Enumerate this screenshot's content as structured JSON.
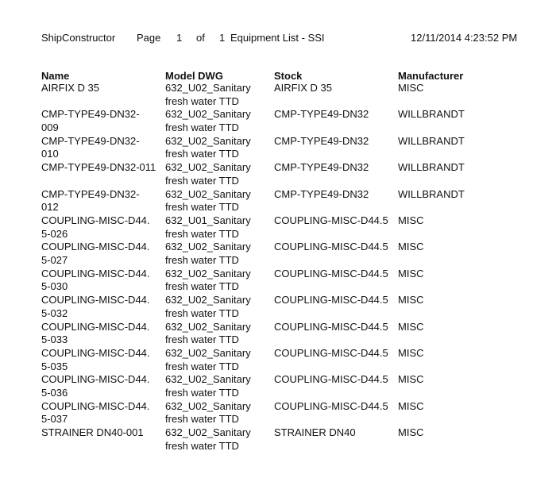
{
  "header": {
    "app_name": "ShipConstructor",
    "page_label": "Page",
    "page_number": "1",
    "of_label": "of",
    "page_total": "1",
    "report_title": "Equipment List - SSI",
    "timestamp": "12/11/2014 4:23:52 PM"
  },
  "table": {
    "columns": [
      "Name",
      "Model DWG",
      "Stock",
      "Manufacturer"
    ],
    "rows": [
      {
        "name": "AIRFIX D 35",
        "model": "632_U02_Sanitary\nfresh water TTD",
        "stock": "AIRFIX D 35",
        "manufacturer": "MISC"
      },
      {
        "name": "CMP-TYPE49-DN32-\n009",
        "model": "632_U02_Sanitary\nfresh water TTD",
        "stock": "CMP-TYPE49-DN32",
        "manufacturer": "WILLBRANDT"
      },
      {
        "name": "CMP-TYPE49-DN32-\n010",
        "model": "632_U02_Sanitary\nfresh water TTD",
        "stock": "CMP-TYPE49-DN32",
        "manufacturer": "WILLBRANDT"
      },
      {
        "name": "CMP-TYPE49-DN32-011",
        "model": "632_U02_Sanitary\nfresh water TTD",
        "stock": "CMP-TYPE49-DN32",
        "manufacturer": "WILLBRANDT"
      },
      {
        "name": "CMP-TYPE49-DN32-\n012",
        "model": "632_U02_Sanitary\nfresh water TTD",
        "stock": "CMP-TYPE49-DN32",
        "manufacturer": "WILLBRANDT"
      },
      {
        "name": "COUPLING-MISC-D44.\n5-026",
        "model": "632_U01_Sanitary\nfresh water TTD",
        "stock": "COUPLING-MISC-D44.5",
        "manufacturer": "MISC"
      },
      {
        "name": "COUPLING-MISC-D44.\n5-027",
        "model": "632_U02_Sanitary\nfresh water TTD",
        "stock": "COUPLING-MISC-D44.5",
        "manufacturer": "MISC"
      },
      {
        "name": "COUPLING-MISC-D44.\n5-030",
        "model": "632_U02_Sanitary\nfresh water TTD",
        "stock": "COUPLING-MISC-D44.5",
        "manufacturer": "MISC"
      },
      {
        "name": "COUPLING-MISC-D44.\n5-032",
        "model": "632_U02_Sanitary\nfresh water TTD",
        "stock": "COUPLING-MISC-D44.5",
        "manufacturer": "MISC"
      },
      {
        "name": "COUPLING-MISC-D44.\n5-033",
        "model": "632_U02_Sanitary\nfresh water TTD",
        "stock": "COUPLING-MISC-D44.5",
        "manufacturer": "MISC"
      },
      {
        "name": "COUPLING-MISC-D44.\n5-035",
        "model": "632_U02_Sanitary\nfresh water TTD",
        "stock": "COUPLING-MISC-D44.5",
        "manufacturer": "MISC"
      },
      {
        "name": "COUPLING-MISC-D44.\n5-036",
        "model": "632_U02_Sanitary\nfresh water TTD",
        "stock": "COUPLING-MISC-D44.5",
        "manufacturer": "MISC"
      },
      {
        "name": "COUPLING-MISC-D44.\n5-037",
        "model": "632_U02_Sanitary\nfresh water TTD",
        "stock": "COUPLING-MISC-D44.5",
        "manufacturer": "MISC"
      },
      {
        "name": "STRAINER DN40-001",
        "model": "632_U02_Sanitary\nfresh water TTD",
        "stock": "STRAINER DN40",
        "manufacturer": "MISC"
      }
    ]
  }
}
